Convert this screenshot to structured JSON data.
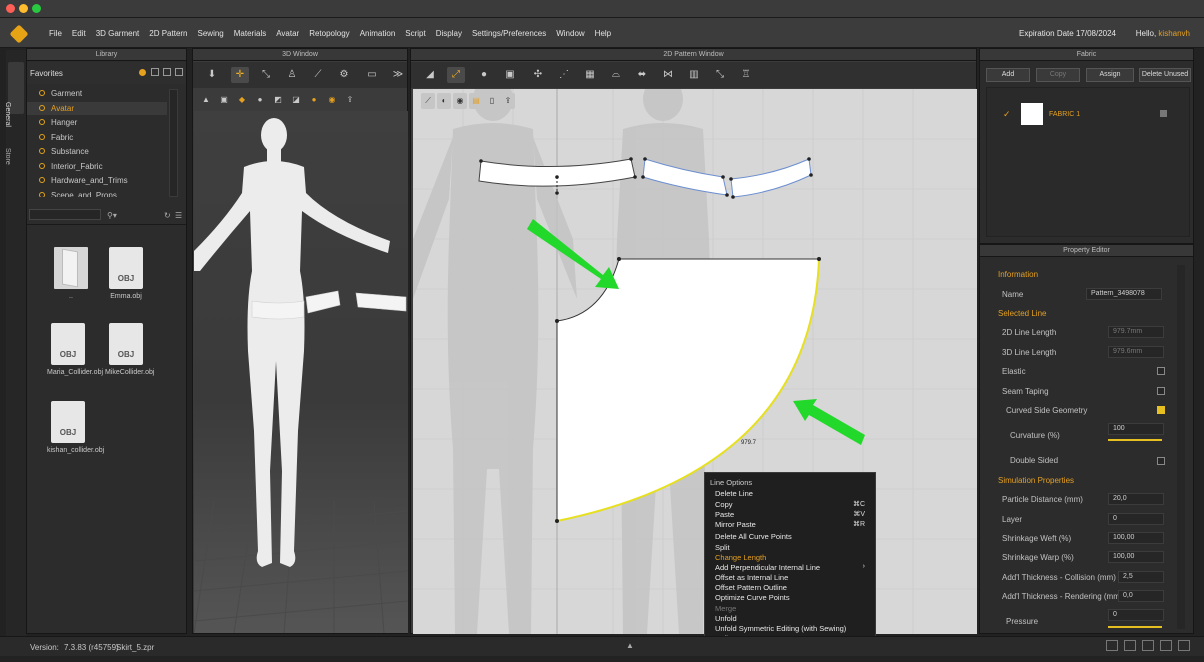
{
  "window": {
    "controls": [
      "close",
      "minimize",
      "maximize"
    ]
  },
  "menu": [
    "File",
    "Edit",
    "3D Garment",
    "2D Pattern",
    "Sewing",
    "Materials",
    "Avatar",
    "Retopology",
    "Animation",
    "Script",
    "Display",
    "Settings/Preferences",
    "Window",
    "Help"
  ],
  "header": {
    "expiration": "Expiration Date 17/08/2024",
    "hello": "Hello,",
    "user": "kishanvh"
  },
  "side_tabs": [
    "General",
    "Store"
  ],
  "library": {
    "title": "Library",
    "favorites": "Favorites",
    "items": [
      "Garment",
      "Avatar",
      "Hanger",
      "Fabric",
      "Substance",
      "Interior_Fabric",
      "Hardware_and_Trims",
      "Scene_and_Props"
    ],
    "selected": "Avatar",
    "files": [
      {
        "label": "..",
        "icon": "folder-icon"
      },
      {
        "label": "Emma.obj",
        "icon": "OBJ"
      },
      {
        "label": "Maria_Collider.obj",
        "icon": "OBJ"
      },
      {
        "label": "MikeCollider.obj",
        "icon": "OBJ"
      },
      {
        "label": "kishan_collider.obj",
        "icon": "OBJ"
      }
    ]
  },
  "window3d": {
    "title": "3D Window"
  },
  "window2d": {
    "title": "2D Pattern Window",
    "measure": "979.7"
  },
  "fabric": {
    "title": "Fabric",
    "buttons": [
      "Add",
      "Copy",
      "Assign",
      "Delete Unused"
    ],
    "items": [
      {
        "name": "FABRIC 1",
        "color": "#ffffff"
      }
    ]
  },
  "property_editor": {
    "title": "Property Editor",
    "information": "Information",
    "name_label": "Name",
    "name_value": "Pattern_3498078",
    "selected_line": "Selected Line",
    "line_2d_label": "2D Line Length",
    "line_2d_value": "979.7mm",
    "line_3d_label": "3D Line Length",
    "line_3d_value": "979.6mm",
    "elastic": "Elastic",
    "seam_taping": "Seam Taping",
    "curved_side": "Curved Side Geometry",
    "curvature_label": "Curvature (%)",
    "curvature_value": "100",
    "double_sided": "Double Sided",
    "simulation": "Simulation Properties",
    "particle_label": "Particle Distance (mm)",
    "particle_value": "20,0",
    "layer_label": "Layer",
    "layer_value": "0",
    "weft_label": "Shrinkage Weft (%)",
    "weft_value": "100,00",
    "warp_label": "Shrinkage Warp (%)",
    "warp_value": "100,00",
    "thick_coll_label": "Add'l Thickness - Collision (mm)",
    "thick_coll_value": "2,5",
    "thick_rend_label": "Add'l Thickness - Rendering (mm)",
    "thick_rend_value": "0,0",
    "pressure_label": "Pressure",
    "pressure_value": "0"
  },
  "context_menu": {
    "title": "Line Options",
    "items": [
      {
        "label": "Delete Line"
      },
      {
        "label": "Copy",
        "shortcut": "⌘C"
      },
      {
        "label": "Paste",
        "shortcut": "⌘V"
      },
      {
        "label": "Mirror Paste",
        "shortcut": "⌘R"
      },
      {
        "label": "Delete All Curve Points"
      },
      {
        "label": "Split"
      },
      {
        "label": "Change Length"
      },
      {
        "label": "Add Perpendicular Internal Line"
      },
      {
        "label": "Offset as Internal Line"
      },
      {
        "label": "Offset Pattern Outline"
      },
      {
        "label": "Optimize Curve Points"
      },
      {
        "label": "Merge"
      },
      {
        "label": "Unfold"
      },
      {
        "label": "Unfold Symmetric Editing (with Sewing)"
      },
      {
        "label": "Roll Up"
      }
    ]
  },
  "status": {
    "version_label": "Version:",
    "version": "7.3.83 (r45759)",
    "file": "Skirt_5.zpr"
  },
  "colors": {
    "accent": "#e5a020",
    "selected_line": "#e6e020",
    "arrow": "#22d82a"
  }
}
